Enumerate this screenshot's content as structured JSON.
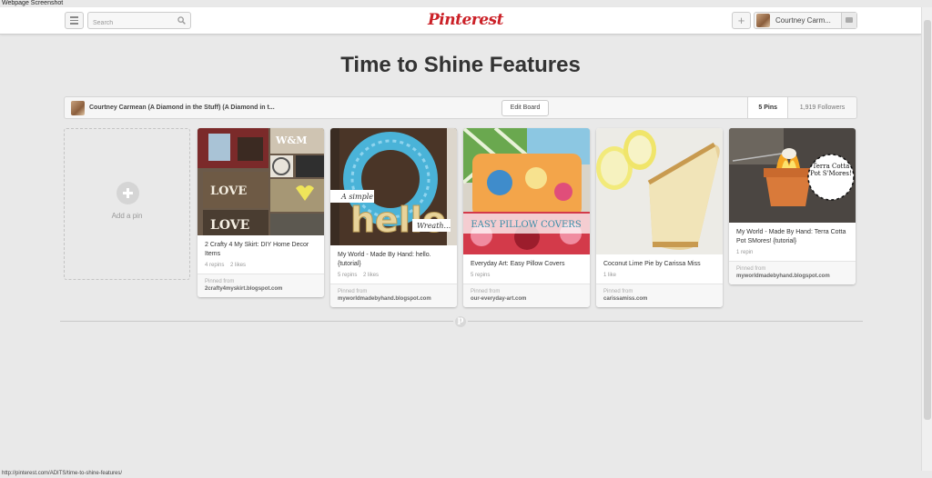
{
  "captions": {
    "top": "Webpage Screenshot",
    "status_url": "http://pinterest.com/ADITS/time-to-shine-features/"
  },
  "header": {
    "search_placeholder": "Search",
    "logo": "Pinterest",
    "plus_label": "+",
    "user_name": "Courtney Carm..."
  },
  "board": {
    "title": "Time to Shine Features",
    "owner": "Courtney Carmean (A Diamond in the Stuff) (A Diamond in t...",
    "edit_label": "Edit Board",
    "pins_count": "5 Pins",
    "followers_count": "1,919 Followers"
  },
  "add_pin": {
    "label": "Add a pin"
  },
  "pins": [
    {
      "description": "2 Crafty 4 My Skirt: DIY Home Decor Items",
      "repins": "4 repins",
      "likes": "2 likes",
      "pinned_from_label": "Pinned from",
      "source": "2crafty4myskirt.blogspot.com",
      "image_text": [
        "W&M",
        "LOVE",
        "LOVE"
      ]
    },
    {
      "description": "My World - Made By Hand: hello. {tutorial}",
      "repins": "5 repins",
      "likes": "2 likes",
      "pinned_from_label": "Pinned from",
      "source": "myworldmadebyhand.blogspot.com",
      "image_text": [
        "A simple",
        "hello",
        "Wreath..."
      ]
    },
    {
      "description": "Everyday Art: Easy Pillow Covers",
      "repins": "5 repins",
      "likes": "",
      "pinned_from_label": "Pinned from",
      "source": "our-everyday-art.com",
      "image_text": [
        "EASY PILLOW COVERS"
      ]
    },
    {
      "description": "Coconut Lime Pie by Carissa Miss",
      "repins": "",
      "likes": "1 like",
      "pinned_from_label": "Pinned from",
      "source": "carissamiss.com",
      "image_text": []
    },
    {
      "description": "My World - Made By Hand: Terra Cotta Pot SMores! {tutorial}",
      "repins": "1 repin",
      "likes": "",
      "pinned_from_label": "Pinned from",
      "source": "myworldmadebyhand.blogspot.com",
      "image_text": [
        "Terra Cotta Pot S'Mores!"
      ]
    }
  ],
  "colors": {
    "brand": "#cb2027",
    "background": "#e9e9e9"
  }
}
